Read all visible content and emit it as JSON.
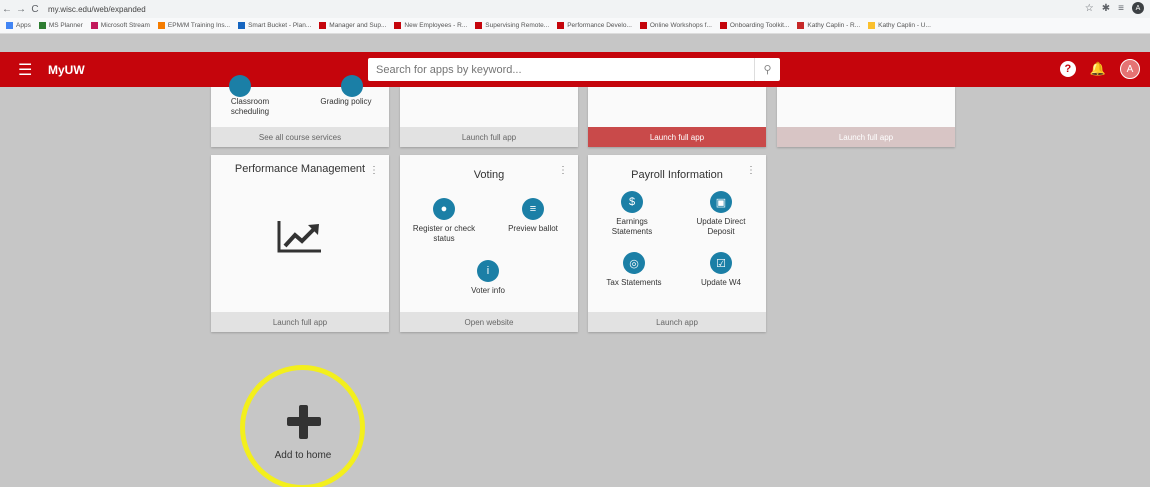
{
  "browser": {
    "url": "my.wisc.edu/web/expanded",
    "profile_initial": "A",
    "bookmarks": [
      "Apps",
      "MS Planner",
      "Microsoft Stream",
      "EPM/M Training Ins...",
      "Smart Bucket - Plan...",
      "Manager and Sup...",
      "New Employees - R...",
      "Supervising Remote...",
      "Performance Develo...",
      "Online Workshops f...",
      "Onboarding Toolkit...",
      "Kathy Caplin - R...",
      "Kathy Caplin - U..."
    ]
  },
  "app": {
    "brand": "MyUW",
    "search_placeholder": "Search for apps by keyword...",
    "avatar_initial": "A"
  },
  "top_cards": [
    {
      "action1": "Classroom scheduling",
      "action2": "Grading policy",
      "footer": "See all course services"
    },
    {
      "footer": "Launch full app"
    },
    {
      "footer": "Launch full app"
    },
    {
      "footer": "Launch full app"
    }
  ],
  "performance": {
    "title": "Performance Management",
    "footer": "Launch full app"
  },
  "voting": {
    "title": "Voting",
    "actions": [
      "Register or check status",
      "Preview ballot",
      "Voter info"
    ],
    "footer": "Open website"
  },
  "payroll": {
    "title": "Payroll Information",
    "actions": [
      "Earnings Statements",
      "Update Direct Deposit",
      "Tax Statements",
      "Update W4"
    ],
    "footer": "Launch app"
  },
  "add_home": {
    "label": "Add to home"
  },
  "colors": {
    "brand_red": "#c5050c",
    "icon_blue": "#1b7fa6",
    "highlight_yellow": "#f3ef1c"
  }
}
